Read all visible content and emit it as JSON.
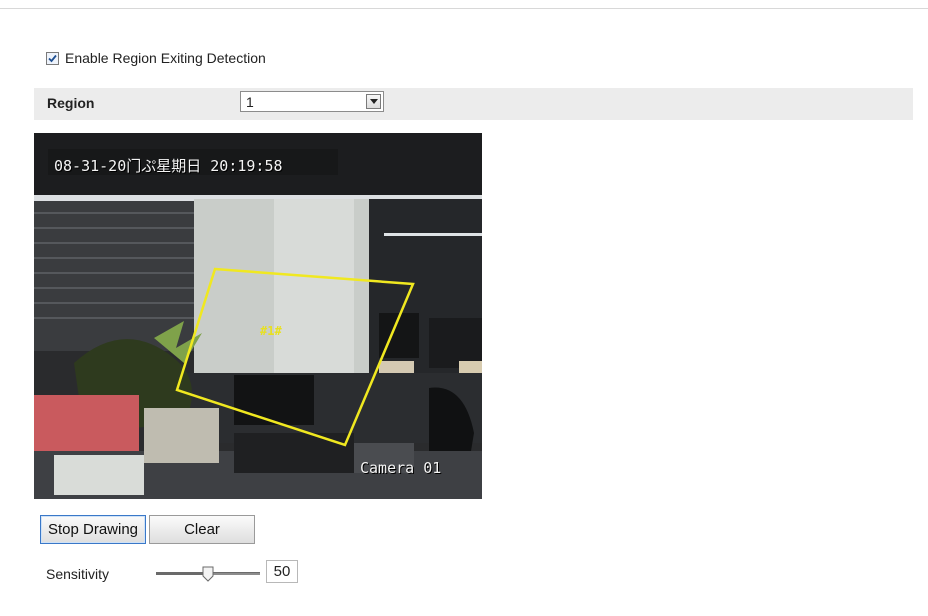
{
  "enable": {
    "label": "Enable Region Exiting Detection",
    "checked": true
  },
  "region": {
    "label": "Region",
    "value": "1"
  },
  "video": {
    "osd_datetime": "08-31-20门ぷ星期日 20:19:58",
    "osd_camera": "Camera 01",
    "region_tag": "#1#"
  },
  "buttons": {
    "stop_drawing": "Stop Drawing",
    "clear": "Clear"
  },
  "sensitivity": {
    "label": "Sensitivity",
    "value": "50",
    "level": 0.5
  },
  "colors": {
    "region_outline": "#f0e820",
    "accent_focus": "#3a78c8"
  }
}
